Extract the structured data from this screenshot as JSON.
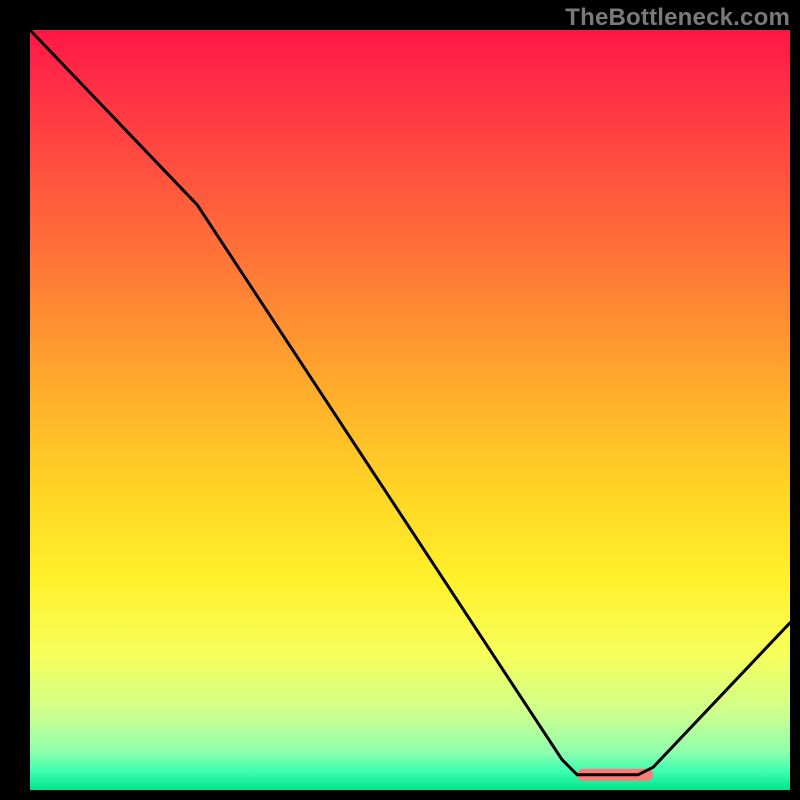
{
  "watermark": "TheBottleneck.com",
  "chart_data": {
    "type": "line",
    "title": "",
    "xlabel": "",
    "ylabel": "",
    "xlim": [
      0,
      100
    ],
    "ylim": [
      0,
      100
    ],
    "grid": false,
    "legend": false,
    "series": [
      {
        "name": "curve",
        "x": [
          0,
          22,
          70,
          72,
          80,
          82,
          100
        ],
        "values": [
          100,
          77,
          4,
          2,
          2,
          3,
          22
        ]
      }
    ],
    "marker": {
      "name": "highlight-band",
      "x_start": 72,
      "x_end": 82,
      "y": 2,
      "color": "#ff7a7a"
    },
    "background_gradient": {
      "stops": [
        {
          "offset": 0.0,
          "color": "#ff1744"
        },
        {
          "offset": 0.06,
          "color": "#ff2a47"
        },
        {
          "offset": 0.18,
          "color": "#ff4f3f"
        },
        {
          "offset": 0.32,
          "color": "#ff7a36"
        },
        {
          "offset": 0.46,
          "color": "#ffa82c"
        },
        {
          "offset": 0.6,
          "color": "#ffd325"
        },
        {
          "offset": 0.72,
          "color": "#fff02a"
        },
        {
          "offset": 0.82,
          "color": "#f8ff5a"
        },
        {
          "offset": 0.9,
          "color": "#ccff8f"
        },
        {
          "offset": 0.95,
          "color": "#8fffae"
        },
        {
          "offset": 0.975,
          "color": "#3fffb0"
        },
        {
          "offset": 1.0,
          "color": "#00e58c"
        }
      ]
    },
    "line_color": "#000000",
    "line_width": 3
  }
}
